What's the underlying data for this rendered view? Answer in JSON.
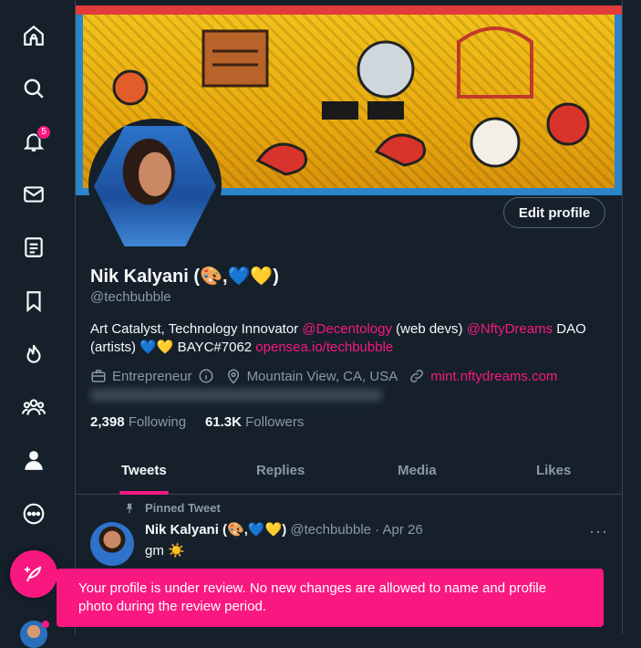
{
  "nav": {
    "items": [
      {
        "name": "home-icon"
      },
      {
        "name": "explore-icon"
      },
      {
        "name": "notifications-icon",
        "badge": "5"
      },
      {
        "name": "messages-icon"
      },
      {
        "name": "lists-icon"
      },
      {
        "name": "bookmarks-icon"
      },
      {
        "name": "communities-icon"
      },
      {
        "name": "people-icon"
      },
      {
        "name": "profile-icon"
      },
      {
        "name": "more-icon"
      }
    ],
    "compose_icon": "feather-plus-icon"
  },
  "profile": {
    "edit_label": "Edit profile",
    "name": "Nik Kalyani (🎨,💙💛)",
    "handle": "@techbubble",
    "bio": {
      "part1": "Art Catalyst, Technology Innovator ",
      "link1": "@Decentology",
      "part2": " (web devs) ",
      "link2": "@NftyDreams",
      "part3": " DAO (artists) 💙💛 BAYC#7062 ",
      "link3": "opensea.io/techbubble"
    },
    "profession": "Entrepreneur",
    "location": "Mountain View, CA, USA",
    "website": "mint.nftydreams.com",
    "following_count": "2,398",
    "following_label": "Following",
    "followers_count": "61.3K",
    "followers_label": "Followers"
  },
  "tabs": [
    {
      "label": "Tweets",
      "active": true
    },
    {
      "label": "Replies",
      "active": false
    },
    {
      "label": "Media",
      "active": false
    },
    {
      "label": "Likes",
      "active": false
    }
  ],
  "pinned_tweet": {
    "pinned_label": "Pinned Tweet",
    "author": "Nik Kalyani (🎨,💙💛)",
    "handle": "@techbubble",
    "separator": "·",
    "date": "Apr 26",
    "text": "gm ☀️"
  },
  "toast": {
    "message": "Your profile is under review. No new changes are allowed to name and profile photo during the review period."
  },
  "colors": {
    "background": "#15202b",
    "accent": "#f91880",
    "muted_text": "#8b98a5",
    "border": "#38444d"
  }
}
